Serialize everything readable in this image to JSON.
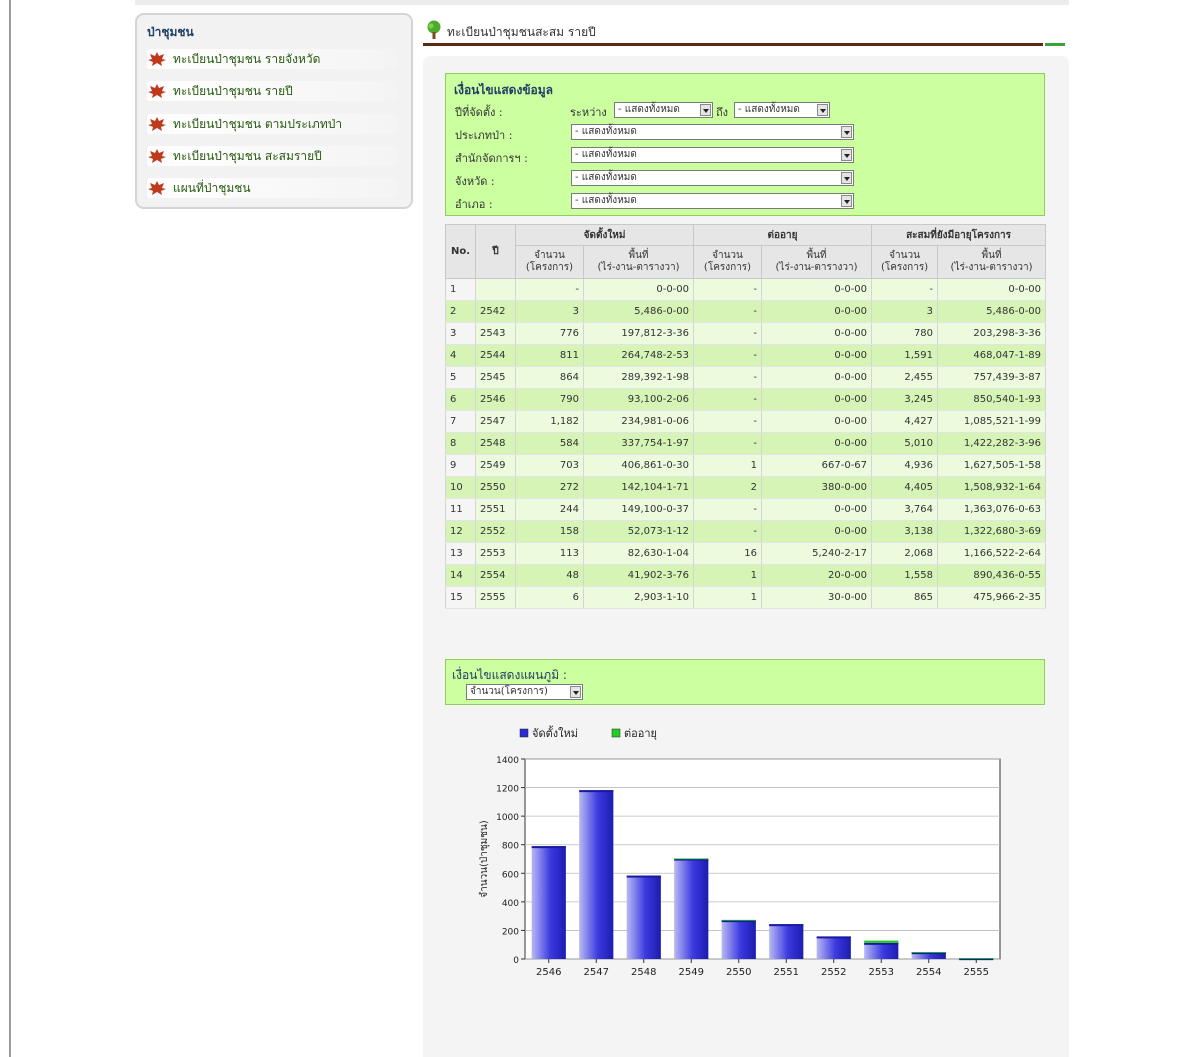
{
  "sidebar": {
    "title": "ป่าชุมชน",
    "items": [
      {
        "label": "ทะเบียนป่าชุมชน รายจังหวัด"
      },
      {
        "label": "ทะเบียนป่าชุมชน รายปี"
      },
      {
        "label": "ทะเบียนป่าชุมชน ตามประเภทป่า"
      },
      {
        "label": "ทะเบียนป่าชุมชน สะสมรายปี"
      },
      {
        "label": "แผนที่ป่าชุมชน"
      }
    ]
  },
  "header": {
    "title": "ทะเบียนป่าชุมชนสะสม รายปี"
  },
  "filters": {
    "heading": "เงื่อนไขแสดงข้อมูล",
    "year_label": "ปีที่จัดตั้ง :",
    "between": "ระหว่าง",
    "to": "ถึง",
    "year_from": "- แสดงทั้งหมด",
    "year_to": "- แสดงทั้งหมด",
    "forest_type_label": "ประเภทป่า :",
    "forest_type": "- แสดงทั้งหมด",
    "office_label": "สำนักจัดการฯ :",
    "office": "- แสดงทั้งหมด",
    "province_label": "จังหวัด :",
    "province": "- แสดงทั้งหมด",
    "district_label": "อำเภอ :",
    "district": "- แสดงทั้งหมด"
  },
  "table": {
    "col_no": "No.",
    "col_year": "ปี",
    "group_new": "จัดตั้งใหม่",
    "group_renew": "ต่ออายุ",
    "group_cum": "สะสมที่ยังมีอายุโครงการ",
    "count_label": "จำนวน",
    "count_unit": "(โครงการ)",
    "area_label": "พื้นที่",
    "area_unit": "(ไร่-งาน-ตารางวา)",
    "rows": [
      {
        "no": "1",
        "year": "",
        "new_count": "-",
        "new_area": "0-0-00",
        "renew_count": "-",
        "renew_area": "0-0-00",
        "cum_count": "-",
        "cum_area": "0-0-00"
      },
      {
        "no": "2",
        "year": "2542",
        "new_count": "3",
        "new_area": "5,486-0-00",
        "renew_count": "-",
        "renew_area": "0-0-00",
        "cum_count": "3",
        "cum_area": "5,486-0-00"
      },
      {
        "no": "3",
        "year": "2543",
        "new_count": "776",
        "new_area": "197,812-3-36",
        "renew_count": "-",
        "renew_area": "0-0-00",
        "cum_count": "780",
        "cum_area": "203,298-3-36"
      },
      {
        "no": "4",
        "year": "2544",
        "new_count": "811",
        "new_area": "264,748-2-53",
        "renew_count": "-",
        "renew_area": "0-0-00",
        "cum_count": "1,591",
        "cum_area": "468,047-1-89"
      },
      {
        "no": "5",
        "year": "2545",
        "new_count": "864",
        "new_area": "289,392-1-98",
        "renew_count": "-",
        "renew_area": "0-0-00",
        "cum_count": "2,455",
        "cum_area": "757,439-3-87"
      },
      {
        "no": "6",
        "year": "2546",
        "new_count": "790",
        "new_area": "93,100-2-06",
        "renew_count": "-",
        "renew_area": "0-0-00",
        "cum_count": "3,245",
        "cum_area": "850,540-1-93"
      },
      {
        "no": "7",
        "year": "2547",
        "new_count": "1,182",
        "new_area": "234,981-0-06",
        "renew_count": "-",
        "renew_area": "0-0-00",
        "cum_count": "4,427",
        "cum_area": "1,085,521-1-99"
      },
      {
        "no": "8",
        "year": "2548",
        "new_count": "584",
        "new_area": "337,754-1-97",
        "renew_count": "-",
        "renew_area": "0-0-00",
        "cum_count": "5,010",
        "cum_area": "1,422,282-3-96"
      },
      {
        "no": "9",
        "year": "2549",
        "new_count": "703",
        "new_area": "406,861-0-30",
        "renew_count": "1",
        "renew_area": "667-0-67",
        "cum_count": "4,936",
        "cum_area": "1,627,505-1-58"
      },
      {
        "no": "10",
        "year": "2550",
        "new_count": "272",
        "new_area": "142,104-1-71",
        "renew_count": "2",
        "renew_area": "380-0-00",
        "cum_count": "4,405",
        "cum_area": "1,508,932-1-64"
      },
      {
        "no": "11",
        "year": "2551",
        "new_count": "244",
        "new_area": "149,100-0-37",
        "renew_count": "-",
        "renew_area": "0-0-00",
        "cum_count": "3,764",
        "cum_area": "1,363,076-0-63"
      },
      {
        "no": "12",
        "year": "2552",
        "new_count": "158",
        "new_area": "52,073-1-12",
        "renew_count": "-",
        "renew_area": "0-0-00",
        "cum_count": "3,138",
        "cum_area": "1,322,680-3-69"
      },
      {
        "no": "13",
        "year": "2553",
        "new_count": "113",
        "new_area": "82,630-1-04",
        "renew_count": "16",
        "renew_area": "5,240-2-17",
        "cum_count": "2,068",
        "cum_area": "1,166,522-2-64"
      },
      {
        "no": "14",
        "year": "2554",
        "new_count": "48",
        "new_area": "41,902-3-76",
        "renew_count": "1",
        "renew_area": "20-0-00",
        "cum_count": "1,558",
        "cum_area": "890,436-0-55"
      },
      {
        "no": "15",
        "year": "2555",
        "new_count": "6",
        "new_area": "2,903-1-10",
        "renew_count": "1",
        "renew_area": "30-0-00",
        "cum_count": "865",
        "cum_area": "475,966-2-35"
      }
    ]
  },
  "chart_filter": {
    "heading": "เงื่อนไขแสดงแผนภูมิ :",
    "selected": "จำนวน(โครงการ)"
  },
  "chart_data": {
    "type": "bar",
    "stacked": true,
    "categories": [
      "2546",
      "2547",
      "2548",
      "2549",
      "2550",
      "2551",
      "2552",
      "2553",
      "2554",
      "2555"
    ],
    "series": [
      {
        "name": "จัดตั้งใหม่",
        "color": "#2b2bd6",
        "values": [
          790,
          1182,
          584,
          703,
          272,
          244,
          158,
          113,
          48,
          6
        ]
      },
      {
        "name": "ต่ออายุ",
        "color": "#22cc22",
        "values": [
          0,
          0,
          0,
          1,
          2,
          0,
          0,
          16,
          1,
          1
        ]
      }
    ],
    "ylabel": "จำนวน(ป่าชุมชน)",
    "ylim": [
      0,
      1400
    ],
    "yticks": [
      0,
      200,
      400,
      600,
      800,
      1000,
      1200,
      1400
    ],
    "grid": true,
    "legend": "top-left"
  },
  "colors": {
    "filter_bg": "#ccffa0",
    "row_light": "#ecfbdd",
    "row_dark": "#d5f4b6",
    "link_green": "#285a0f",
    "header_brown": "#5a2a14"
  }
}
